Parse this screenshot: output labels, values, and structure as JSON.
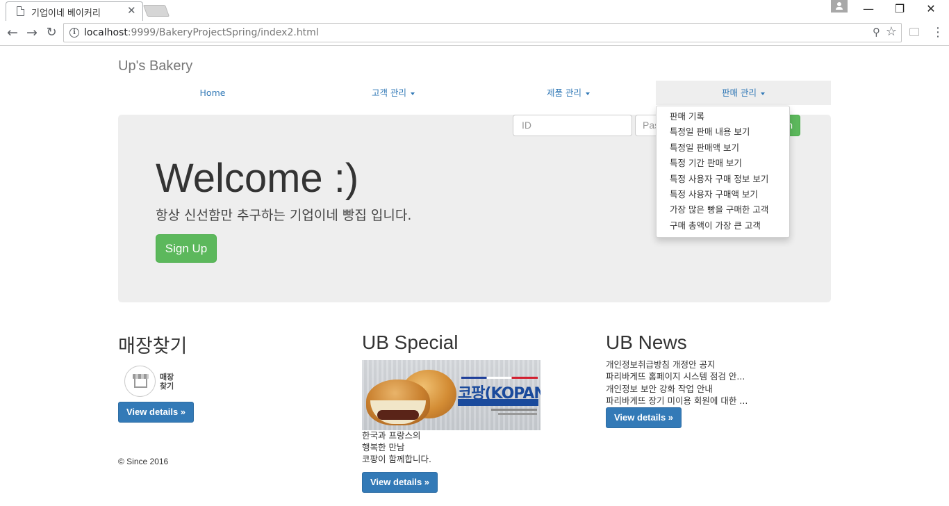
{
  "browser": {
    "tab_title": "기업이네 베이커리",
    "tab_close": "✕",
    "url_host": "localhost",
    "url_rest": ":9999/BakeryProjectSpring/index2.html",
    "window_controls": {
      "minimize": "—",
      "maximize": "❐",
      "close": "✕"
    },
    "icons": [
      "page-icon",
      "back-icon",
      "forward-icon",
      "reload-icon",
      "info-icon",
      "zoom-icon",
      "star-icon",
      "extension-icon",
      "menu-icon",
      "profile-icon"
    ]
  },
  "site": {
    "brand": "Up's Bakery",
    "nav": [
      {
        "label": "Home"
      },
      {
        "label": "고객 관리"
      },
      {
        "label": "제품 관리"
      },
      {
        "label": "판매 관리"
      }
    ],
    "sales_menu": [
      "판매 기록",
      "특정일 판매 내용 보기",
      "특정일 판매액 보기",
      "특정 기간 판매 보기",
      "특정 사용자 구매 정보 보기",
      "특정 사용자 구매액 보기",
      "가장 많은 빵을 구매한 고객",
      "구매 총액이 가장 큰 고객"
    ],
    "login": {
      "id_placeholder": "ID",
      "pw_placeholder": "Pas",
      "signin_label": "n"
    },
    "jumbotron": {
      "title": "Welcome :)",
      "subtitle": "항상 신선함만 추구하는 기업이네 빵집 입니다.",
      "signup_label": "Sign Up"
    },
    "store": {
      "heading": "매장찾기",
      "label_line1": "매장",
      "label_line2": "찾기",
      "button": "View details »"
    },
    "special": {
      "heading": "UB Special",
      "banner_logo": "코팡(KOPAN)",
      "lines": [
        "한국과 프랑스의",
        "행복한 만남",
        "코팡이 함께합니다."
      ],
      "button": "View details »"
    },
    "news": {
      "heading": "UB News",
      "items": [
        "개인정보취급방침 개정안 공지",
        "파리바게뜨 홈페이지 시스템 점검 안...",
        "개인정보 보안 강화 작업 안내",
        "파리바게뜨 장기 미이용 회원에 대한 ..."
      ],
      "button": "View details »"
    },
    "footer": "© Since 2016"
  },
  "colors": {
    "link": "#337ab7",
    "success": "#5cb85c",
    "primary": "#337ab7",
    "jumbotron_bg": "#eeeeee"
  }
}
